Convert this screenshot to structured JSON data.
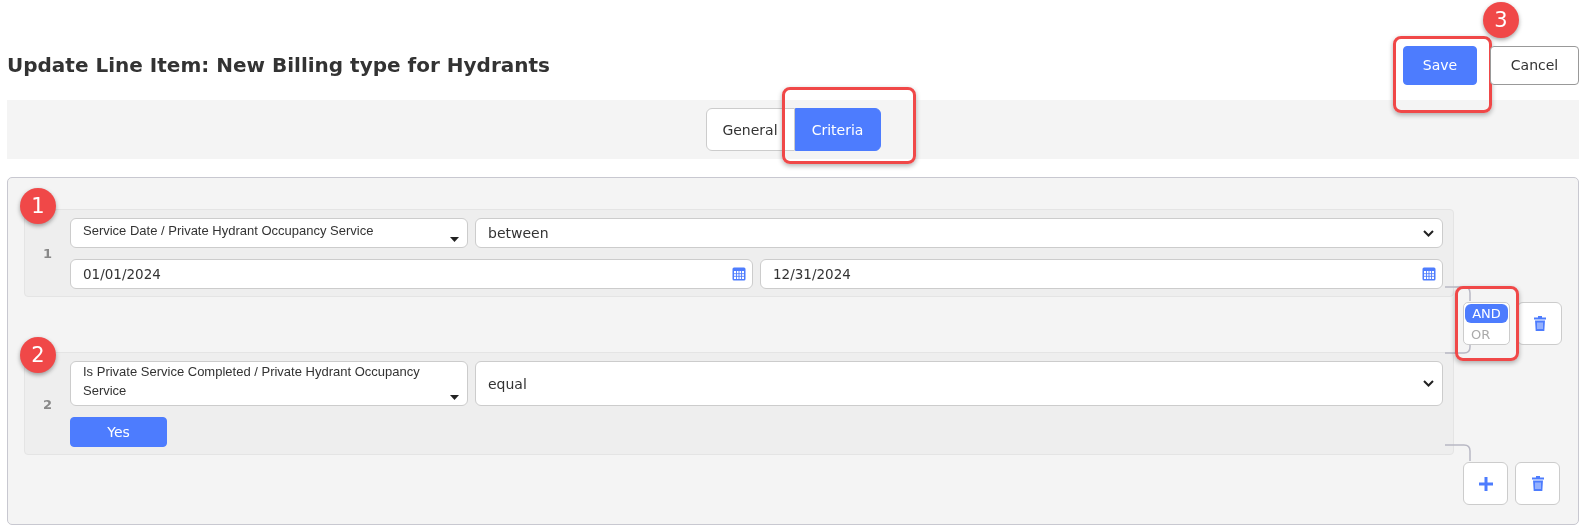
{
  "title": "Update Line Item: New Billing type for Hydrants",
  "actions": [
    {
      "label": "Save",
      "kind": "primary",
      "highlighted": true,
      "badge": "3"
    },
    {
      "label": "Cancel",
      "kind": "secondary",
      "highlighted": false
    }
  ],
  "tabs": [
    {
      "label": "General",
      "selected": false,
      "highlighted": false
    },
    {
      "label": "Criteria",
      "selected": true,
      "highlighted": true
    }
  ],
  "rules": [
    {
      "number": "1",
      "badge": "1",
      "field": "Service Date / Private Hydrant Occupancy Service",
      "operator": "between",
      "kind": "date_range",
      "values": [
        "01/01/2024",
        "12/31/2024"
      ]
    },
    {
      "number": "2",
      "badge": "2",
      "field": "Is Private Service Completed / Private Hydrant Occupancy Service",
      "operator": "equal",
      "kind": "toggle",
      "values": [
        "Yes"
      ]
    }
  ],
  "conjunction": {
    "highlighted": true,
    "options": [
      {
        "label": "AND",
        "selected": true
      },
      {
        "label": "OR",
        "selected": false
      }
    ]
  }
}
